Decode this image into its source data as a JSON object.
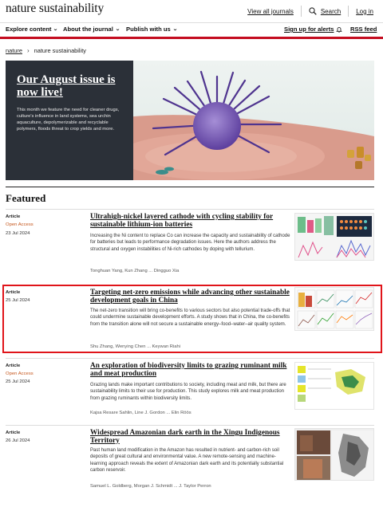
{
  "site": {
    "brand": "nature sustainability"
  },
  "top_links": {
    "view_all_journals": "View all journals",
    "search": "Search",
    "login": "Log in"
  },
  "nav": {
    "explore": "Explore content",
    "about": "About the journal",
    "publish": "Publish with us",
    "alerts": "Sign up for alerts",
    "rss": "RSS feed"
  },
  "breadcrumb": {
    "home": "nature",
    "current": "nature sustainability"
  },
  "hero": {
    "title": "Our August issue is now live!",
    "description": "This month we feature the need for cleaner drugs, culture's influence in land systems, sea urchin aquaculture, depolymerizable and recyclable polymers, floods threat to crop yields and more."
  },
  "featured_heading": "Featured",
  "articles": [
    {
      "type": "Article",
      "open_access": "Open Access",
      "date": "23 Jul 2024",
      "title": "Ultrahigh-nickel layered cathode with cycling stability for sustainable lithium-ion batteries",
      "description": "Increasing the Ni content to replace Co can increase the capacity and sustainability of cathode for batteries but leads to performance degradation issues. Here the authors address the structural and oxygen instabilities of Ni-rich cathodes by doping with tellurium.",
      "authors": "Tonghuan Yang, Kun Zhang ... Dingguo Xia"
    },
    {
      "type": "Article",
      "open_access": "",
      "date": "25 Jul 2024",
      "title": "Targeting net-zero emissions while advancing other sustainable development goals in China",
      "description": "The net-zero transition will bring co-benefits to various sectors but also potential trade-offs that could undermine sustainable development efforts. A study shows that in China, the co-benefits from the transition alone will not secure a sustainable energy–food–water–air quality system.",
      "authors": "Shu Zhang, Wenying Chen ... Keywan Riahi"
    },
    {
      "type": "Article",
      "open_access": "Open Access",
      "date": "25 Jul 2024",
      "title": "An exploration of biodiversity limits to grazing ruminant milk and meat production",
      "description": "Grazing lands make important contributions to society, including meat and milk, but there are sustainability limits to their use for production. This study explores milk and meat production from grazing ruminants within biodiversity limits.",
      "authors": "Kajsa Resare Sahlin, Line J. Gordon ... Elin Röös"
    },
    {
      "type": "Article",
      "open_access": "",
      "date": "26 Jul 2024",
      "title": "Widespread Amazonian dark earth in the Xingu Indigenous Territory",
      "description": "Past human land modification in the Amazon has resulted in nutrient- and carbon-rich soil deposits of great cultural and environmental value. A new remote-sensing and machine-learning approach reveals the extent of Amazonian dark earth and its potentially substantial carbon reservoir.",
      "authors": "Samuel L. Goldberg, Morgan J. Schmidt ... J. Taylor Perron"
    }
  ],
  "colors": {
    "accent_red": "#c40d20",
    "open_access": "#c5561c",
    "hero_box": "#2b3038",
    "highlight": "#e0141a"
  }
}
